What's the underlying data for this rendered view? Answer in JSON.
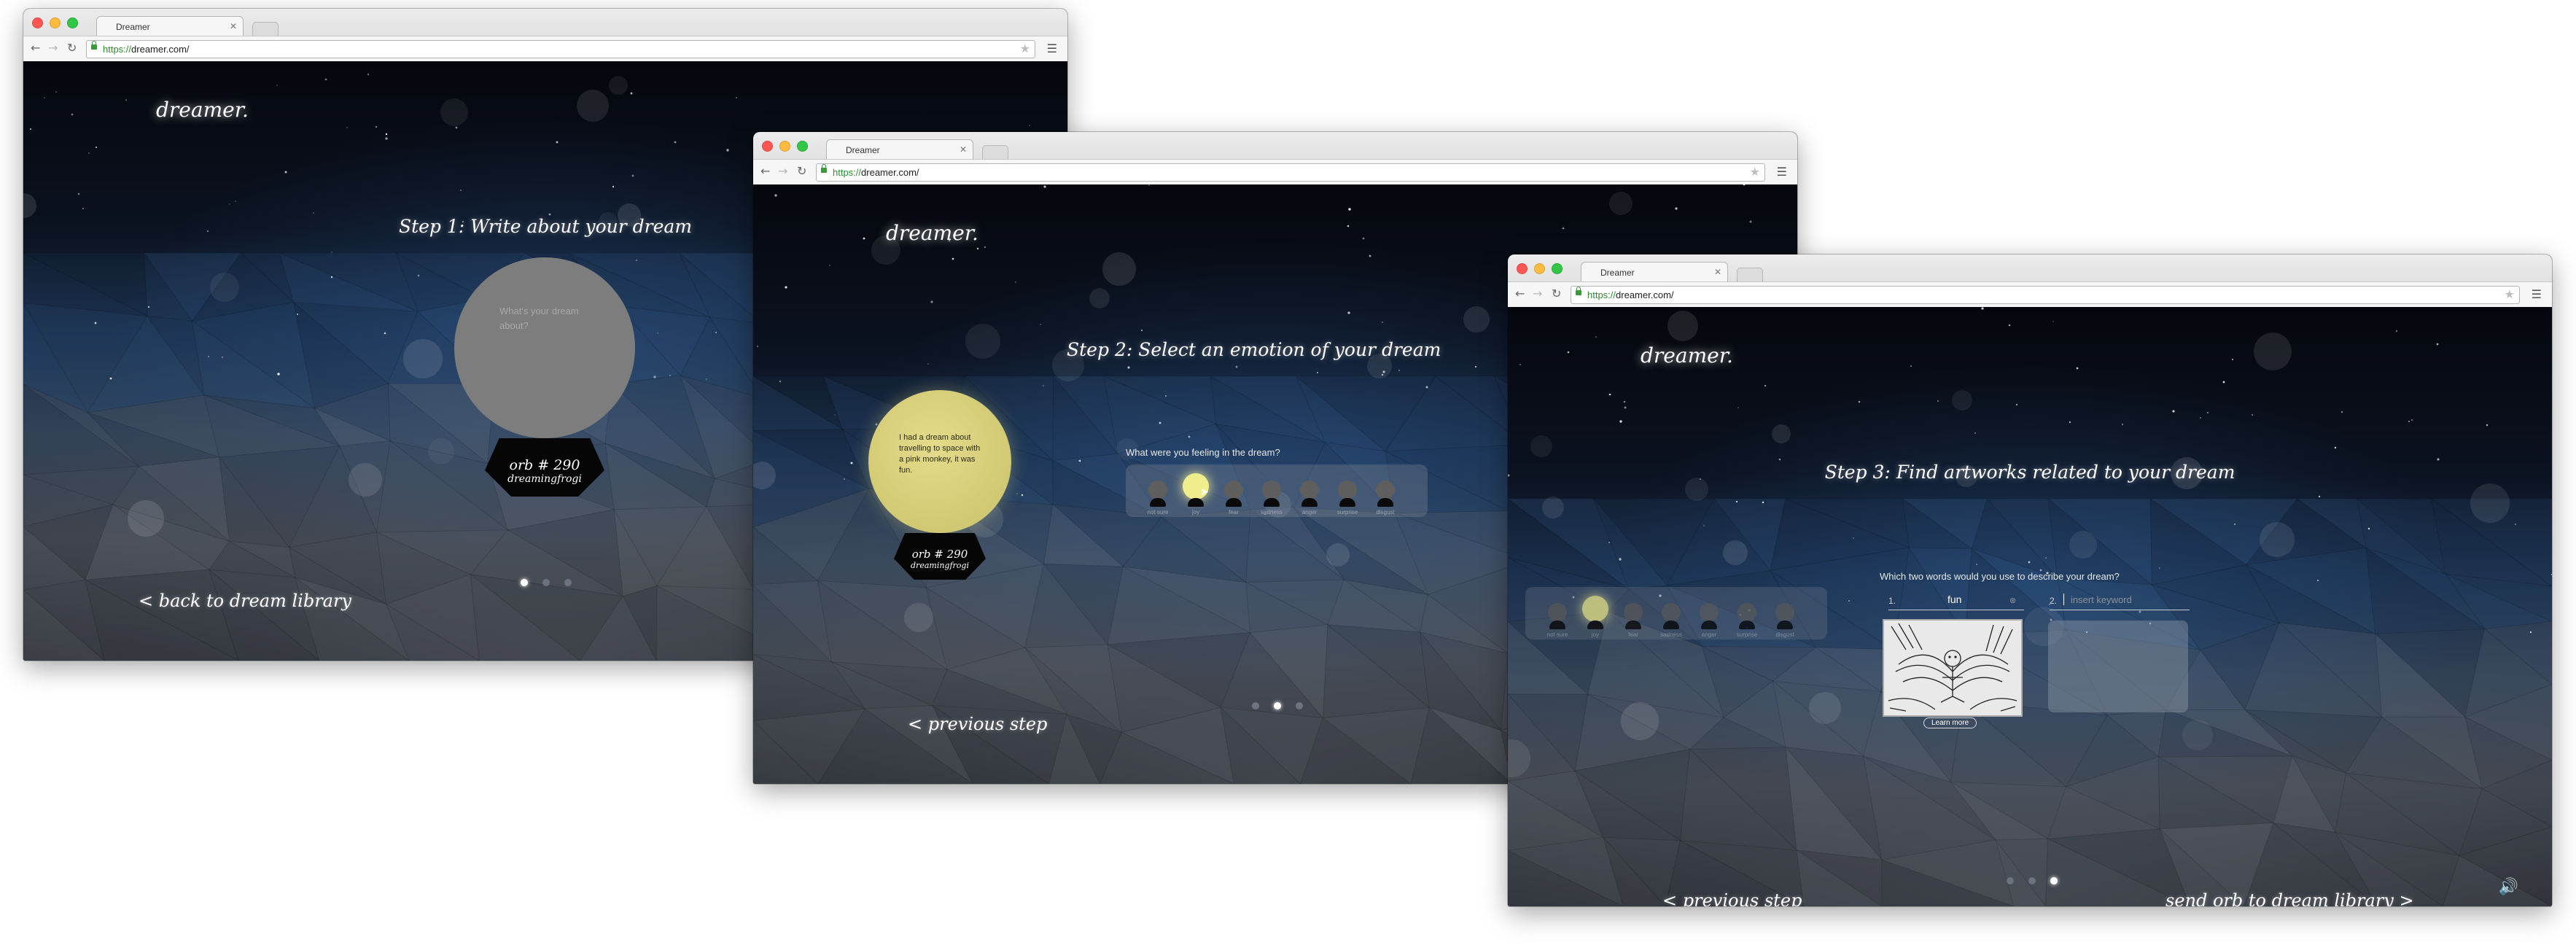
{
  "browser": {
    "tab_title": "Dreamer",
    "url_protocol": "https://",
    "url_rest": "dreamer.com/"
  },
  "logo": "dreamer.",
  "screen1": {
    "step_title": "Step 1: Write about your dream",
    "orb_placeholder": "What's your dream about?",
    "orb_number": "orb # 290",
    "orb_author": "dreamingfrogi",
    "back_link": "< back to dream library",
    "pager_active": 1
  },
  "screen2": {
    "step_title": "Step 2: Select an emotion of your dream",
    "orb_text": "I had a dream about travelling to space with a pink monkey, it was fun.",
    "orb_number": "orb # 290",
    "orb_author": "dreamingfrogi",
    "question": "What were you feeling in the dream?",
    "emotions": [
      "not sure",
      "joy",
      "fear",
      "sadness",
      "anger",
      "surprise",
      "disgust"
    ],
    "selected": "joy",
    "prev_link": "< previous step",
    "pager_active": 2
  },
  "screen3": {
    "step_title": "Step 3: Find artworks related to your dream",
    "question": "Which two words would you use to describe your dream?",
    "kw1_num": "1.",
    "kw1_value": "fun",
    "kw1_clear": "⊗",
    "kw2_num": "2.",
    "kw2_placeholder": "insert keyword",
    "learn_more": "Learn more",
    "prev_link": "< previous step",
    "send_link": "send orb to dream library >",
    "pager_active": 3
  },
  "colors": {
    "orb_grey": "#7d7d7d",
    "orb_yellow": "#d9d27a",
    "joy_glow": "#f0ee8c",
    "accent_green": "#2e8b2e"
  },
  "icons": [
    "back-arrow-icon",
    "forward-arrow-icon",
    "reload-icon",
    "lock-icon",
    "star-icon",
    "menu-icon",
    "speaker-icon"
  ]
}
